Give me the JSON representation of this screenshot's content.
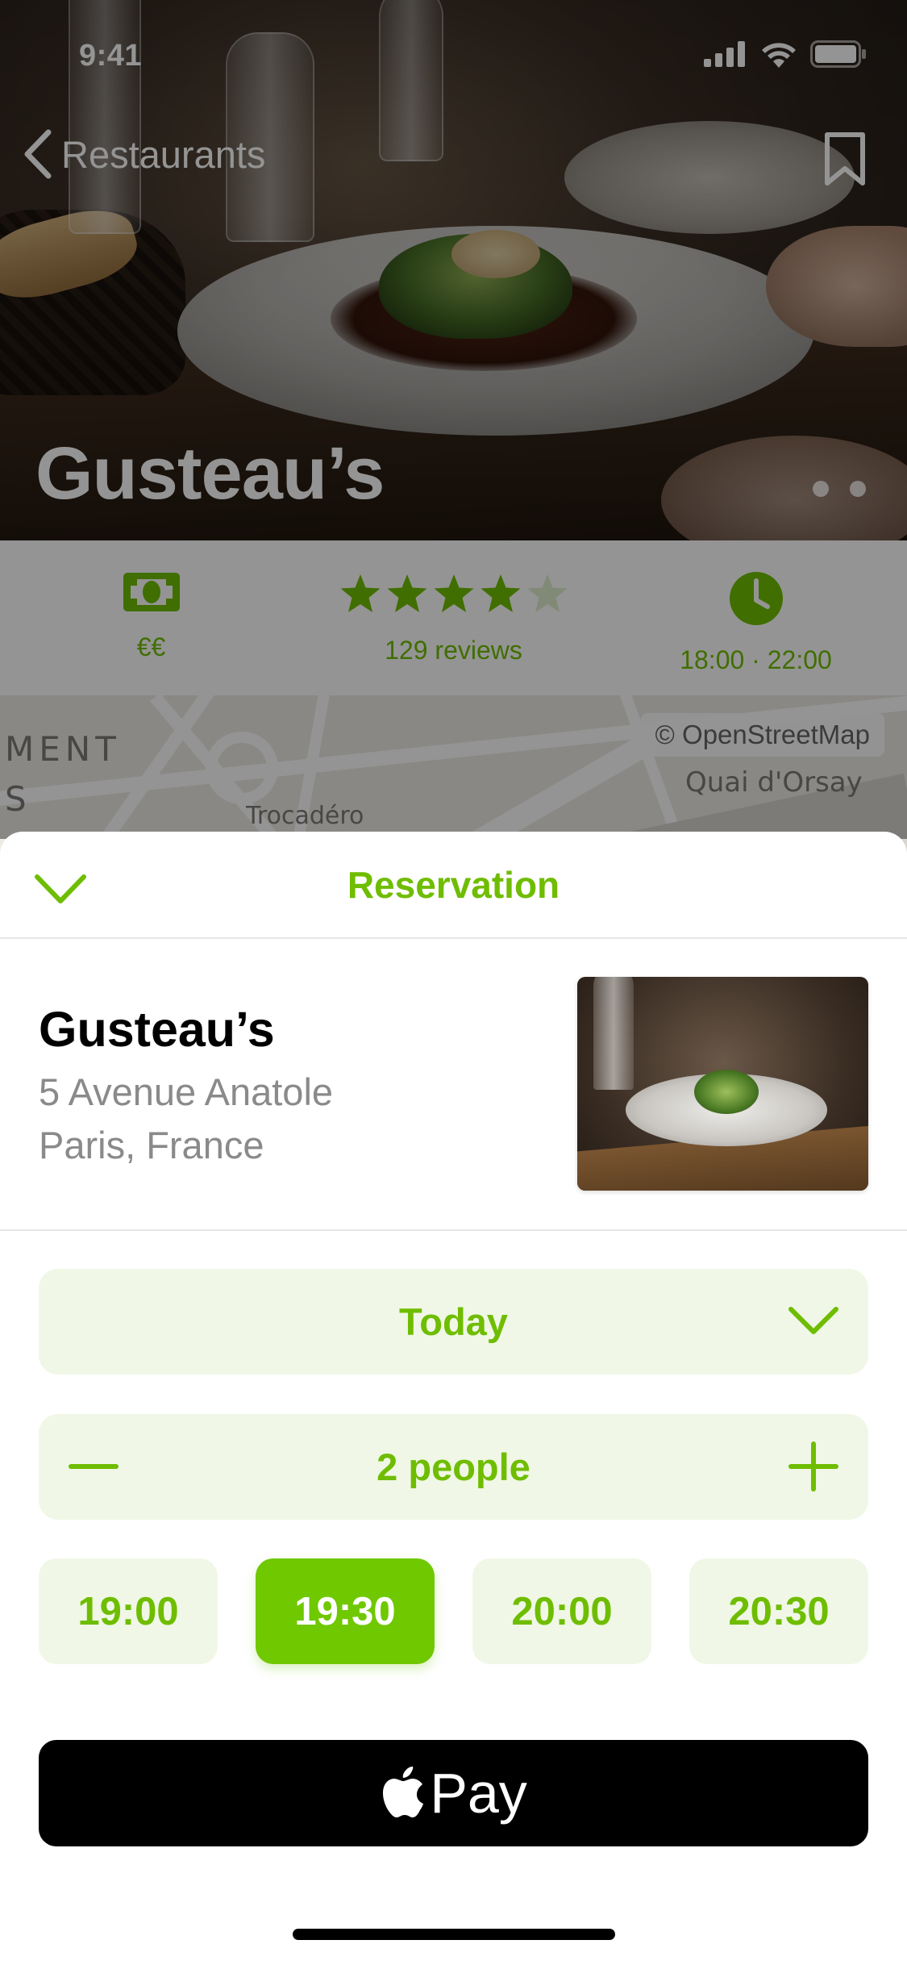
{
  "status_bar": {
    "time": "9:41"
  },
  "nav": {
    "back_label": "Restaurants"
  },
  "hero": {
    "title": "Gusteau’s"
  },
  "info": {
    "price": "€€",
    "rating": 4,
    "rating_max": 5,
    "reviews": "129 reviews",
    "hours": "18:00 · 22:00"
  },
  "map": {
    "attribution": "© OpenStreetMap",
    "labels": {
      "quai": "Quai d'Orsay",
      "trocadero": "Trocadéro",
      "ment": "MENT",
      "s": "S"
    }
  },
  "sheet": {
    "title": "Reservation",
    "restaurant": {
      "name": "Gusteau’s",
      "address_line1": "5 Avenue Anatole",
      "address_line2": "Paris, France"
    },
    "day": "Today",
    "people": "2 people",
    "times": [
      "19:00",
      "19:30",
      "20:00",
      "20:30"
    ],
    "selected_time": "19:30",
    "pay_label": "Pay"
  },
  "colors": {
    "accent": "#6fbd00",
    "accent_light": "#f0f7e6",
    "selected": "#6fc800"
  },
  "icons": {
    "back": "chevron-left-icon",
    "bookmark": "bookmark-icon",
    "price": "banknote-icon",
    "hours": "clock-icon",
    "collapse": "chevron-down-icon",
    "decrement": "minus-icon",
    "increment": "plus-icon",
    "apple": "apple-logo-icon"
  }
}
